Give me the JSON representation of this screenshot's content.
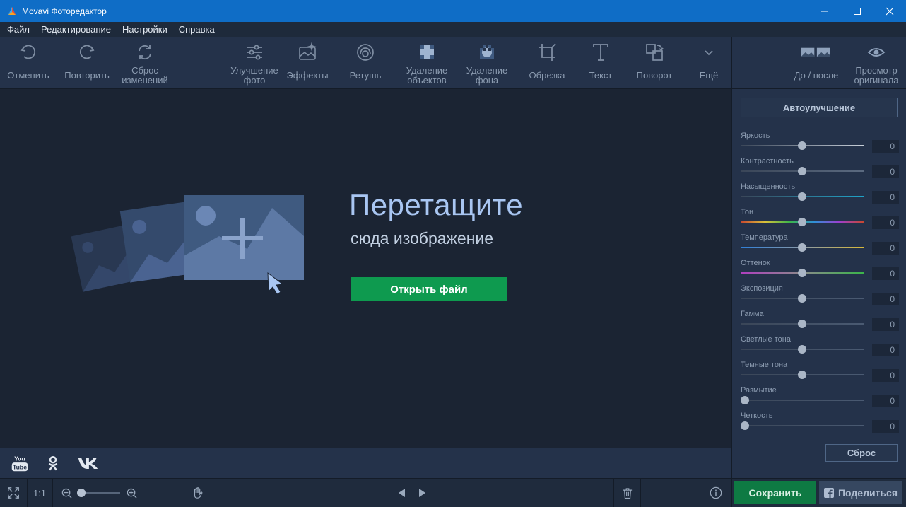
{
  "window": {
    "title": "Movavi Фоторедактор"
  },
  "menu": [
    "Файл",
    "Редактирование",
    "Настройки",
    "Справка"
  ],
  "toolbar": {
    "undo": "Отменить",
    "redo": "Повторить",
    "reset_1": "Сброс",
    "reset_2": "изменений",
    "enhance_1": "Улучшение",
    "enhance_2": "фото",
    "effects": "Эффекты",
    "retouch": "Ретушь",
    "remove_obj_1": "Удаление",
    "remove_obj_2": "объектов",
    "remove_bg_1": "Удаление",
    "remove_bg_2": "фона",
    "crop": "Обрезка",
    "text": "Текст",
    "rotate": "Поворот",
    "more": "Ещё",
    "before_after": "До / после",
    "preview_1": "Просмотр",
    "preview_2": "оригинала"
  },
  "canvas": {
    "drop_title": "Перетащите",
    "drop_subtitle": "сюда изображение",
    "open_button": "Открыть файл"
  },
  "bottombar": {
    "ratio": "1:1"
  },
  "panel": {
    "auto_button": "Автоулучшение",
    "reset_button": "Сброс",
    "sliders": [
      {
        "label": "Яркость",
        "value": "0",
        "level": 0.5
      },
      {
        "label": "Контрастность",
        "value": "0",
        "level": 0.5
      },
      {
        "label": "Насыщенность",
        "value": "0",
        "level": 0.5
      },
      {
        "label": "Тон",
        "value": "0",
        "level": 0.5
      },
      {
        "label": "Температура",
        "value": "0",
        "level": 0.5
      },
      {
        "label": "Оттенок",
        "value": "0",
        "level": 0.5
      },
      {
        "label": "Экспозиция",
        "value": "0",
        "level": 0.5
      },
      {
        "label": "Гамма",
        "value": "0",
        "level": 0.5
      },
      {
        "label": "Светлые тона",
        "value": "0",
        "level": 0.5
      },
      {
        "label": "Темные тона",
        "value": "0",
        "level": 0.5
      },
      {
        "label": "Размытие",
        "value": "0",
        "level": 0
      },
      {
        "label": "Четкость",
        "value": "0",
        "level": 0
      }
    ]
  },
  "actions": {
    "save": "Сохранить",
    "share": "Поделиться"
  },
  "colors": {
    "titlebar": "#0f6dc6",
    "accent_green": "#0e9a4f",
    "drop_title": "#a9c6f2"
  }
}
